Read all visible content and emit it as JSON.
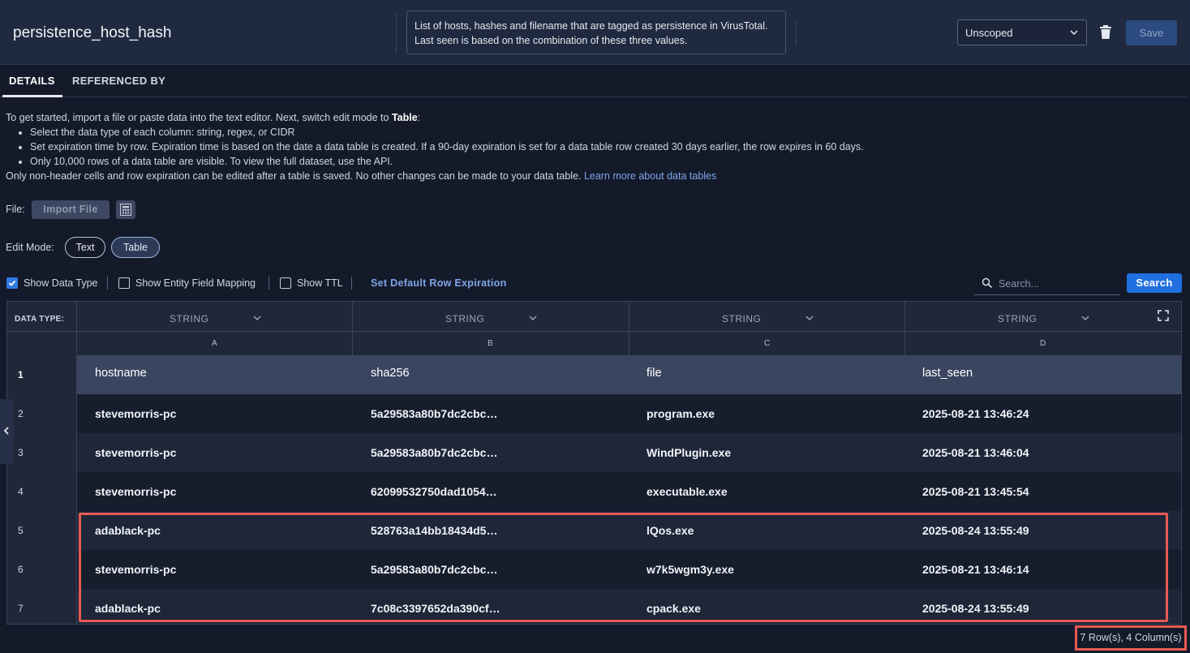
{
  "header": {
    "title": "persistence_host_hash",
    "description": "List of hosts, hashes and filename that are tagged as persistence in VirusTotal. Last seen is based on the combination of these three values.",
    "scope": "Unscoped",
    "save_label": "Save"
  },
  "tabs": [
    {
      "label": "DETAILS",
      "active": true
    },
    {
      "label": "REFERENCED BY",
      "active": false
    }
  ],
  "instructions": {
    "intro_prefix": "To get started, import a file or paste data into the text editor. Next, switch edit mode to ",
    "intro_bold": "Table",
    "intro_suffix": ":",
    "bullets": [
      "Select the data type of each column: string, regex, or CIDR",
      "Set expiration time by row. Expiration time is based on the date a data table is created. If a 90-day expiration is set for a data table row created 30 days earlier, the row expires in 60 days.",
      "Only 10,000 rows of a data table are visible. To view the full dataset, use the API."
    ],
    "note": "Only non-header cells and row expiration can be edited after a table is saved. No other changes can be made to your data table. ",
    "link": "Learn more about data tables"
  },
  "file": {
    "label": "File:",
    "import_label": "Import File"
  },
  "edit_mode": {
    "label": "Edit Mode:",
    "options": [
      "Text",
      "Table"
    ],
    "selected": "Table"
  },
  "toolbar": {
    "show_data_type": "Show Data Type",
    "show_entity_mapping": "Show Entity Field Mapping",
    "show_ttl": "Show TTL",
    "set_default_expiration": "Set Default Row Expiration",
    "search_placeholder": "Search...",
    "search_label": "Search"
  },
  "table": {
    "data_type_label": "DATA TYPE:",
    "columns": [
      {
        "letter": "A",
        "type": "STRING"
      },
      {
        "letter": "B",
        "type": "STRING"
      },
      {
        "letter": "C",
        "type": "STRING"
      },
      {
        "letter": "D",
        "type": "STRING"
      }
    ],
    "rows": [
      {
        "num": "1",
        "cells": [
          "hostname",
          "sha256",
          "file",
          "last_seen"
        ]
      },
      {
        "num": "2",
        "cells": [
          "stevemorris-pc",
          "5a29583a80b7dc2cbc…",
          "program.exe",
          "2025-08-21 13:46:24"
        ]
      },
      {
        "num": "3",
        "cells": [
          "stevemorris-pc",
          "5a29583a80b7dc2cbc…",
          "WindPlugin.exe",
          "2025-08-21 13:46:04"
        ]
      },
      {
        "num": "4",
        "cells": [
          "stevemorris-pc",
          "62099532750dad1054…",
          "executable.exe",
          "2025-08-21 13:45:54"
        ]
      },
      {
        "num": "5",
        "cells": [
          "adablack-pc",
          "528763a14bb18434d5…",
          "lQos.exe",
          "2025-08-24 13:55:49"
        ]
      },
      {
        "num": "6",
        "cells": [
          "stevemorris-pc",
          "5a29583a80b7dc2cbc…",
          "w7k5wgm3y.exe",
          "2025-08-21 13:46:14"
        ]
      },
      {
        "num": "7",
        "cells": [
          "adablack-pc",
          "7c08c3397652da390cf…",
          "cpack.exe",
          "2025-08-24 13:55:49"
        ]
      }
    ]
  },
  "footer": {
    "count": "7 Row(s), 4 Column(s)"
  },
  "colors": {
    "accent": "#1f6fe0",
    "highlight": "#e85a55",
    "background": "#141a2a"
  }
}
